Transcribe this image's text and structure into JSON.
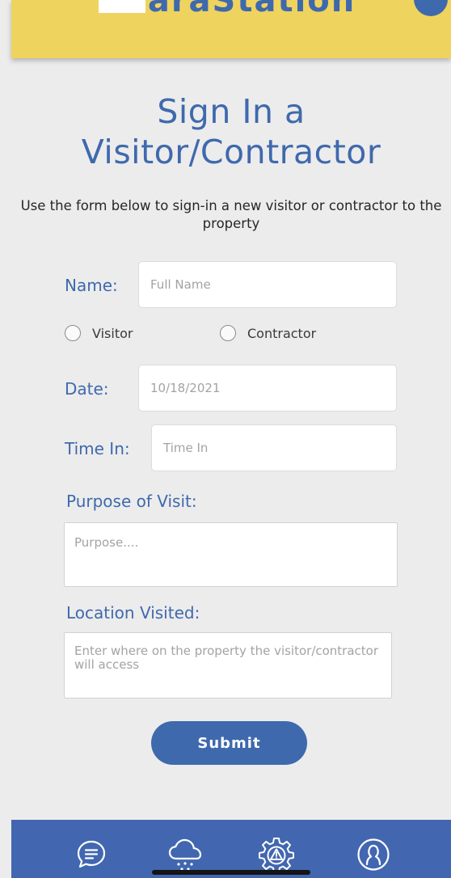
{
  "header": {
    "logo_text": "GaraStation",
    "avatar_icon": "user-avatar"
  },
  "page": {
    "title": "Sign In a Visitor/Contractor",
    "subtitle": "Use the form below to sign-in a new visitor or contractor to the property"
  },
  "form": {
    "name": {
      "label": "Name:",
      "placeholder": "Full Name",
      "value": ""
    },
    "visitor_type": {
      "options": [
        {
          "label": "Visitor",
          "selected": false
        },
        {
          "label": "Contractor",
          "selected": false
        }
      ]
    },
    "date": {
      "label": "Date:",
      "placeholder": "10/18/2021",
      "value": ""
    },
    "time_in": {
      "label": "Time In:",
      "placeholder": "Time In",
      "value": ""
    },
    "purpose": {
      "label": "Purpose of Visit:",
      "placeholder": "Purpose....",
      "value": ""
    },
    "location": {
      "label": "Location Visited:",
      "placeholder": "Enter where on the property the visitor/contractor will access",
      "value": ""
    },
    "submit_label": "Submit"
  },
  "bottom_nav": {
    "items": [
      {
        "icon": "chat-bubble-icon"
      },
      {
        "icon": "rain-cloud-icon"
      },
      {
        "icon": "gear-alert-icon"
      },
      {
        "icon": "profile-icon"
      }
    ]
  },
  "colors": {
    "brand_blue": "#3f69ad",
    "header_yellow": "#efd35f",
    "nav_blue": "#4267b0",
    "background": "#ececec"
  }
}
